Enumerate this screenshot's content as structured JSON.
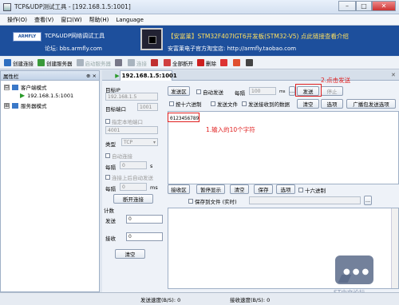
{
  "window": {
    "title": "TCP&UDP测试工具 - [192.168.1.5:1001]",
    "minimize": "–",
    "maximize": "□",
    "close": "✕"
  },
  "menu": [
    "操作(O)",
    "查看(V)",
    "窗口(W)",
    "帮助(H)",
    "Language"
  ],
  "banner": {
    "logo": "ARMFLY",
    "app_name": "TCP&UDP网络调试工具",
    "forum": "论坛: bbs.armfly.com",
    "ad_line1": "【安富莱】STM32F407IGT6开发板(STM32-V5) 点此链接查看介绍",
    "ad_line2": "安富莱电子官方淘宝店: http://armfly.taobao.com"
  },
  "toolbar": [
    {
      "label": "创建连接",
      "icon": "create-connection-icon",
      "enabled": true,
      "color": "#2f6fc0"
    },
    {
      "label": "创建服务器",
      "icon": "create-server-icon",
      "enabled": true,
      "color": "#3a9a3a"
    },
    {
      "label": "启动服务器",
      "icon": "start-server-icon",
      "enabled": false,
      "color": "#a9b4bf"
    },
    {
      "label": "",
      "icon": "settings-icon",
      "enabled": true,
      "color": "#778"
    },
    {
      "label": "连接",
      "icon": "connect-icon",
      "enabled": false,
      "color": "#a9b4bf"
    },
    {
      "label": "",
      "icon": "disconnect-icon",
      "enabled": true,
      "color": "#c03030"
    },
    {
      "label": "全部断开",
      "icon": "disconnect-all-icon",
      "enabled": true,
      "color": "#d04040"
    },
    {
      "label": "删除",
      "icon": "delete-icon",
      "enabled": true,
      "color": "#cc2020"
    },
    {
      "label": "",
      "icon": "delete-all-icon",
      "enabled": true,
      "color": "#dd3333"
    },
    {
      "label": "",
      "icon": "record-icon",
      "enabled": true,
      "color": "#e05030"
    },
    {
      "label": "",
      "icon": "help-icon",
      "enabled": true,
      "color": "#444"
    }
  ],
  "sidebar": {
    "header": "属性栏",
    "pin": "⊕ ×",
    "tree": [
      {
        "label": "客户端模式",
        "expander": "⊟"
      },
      {
        "label": "192.168.1.5:1001"
      },
      {
        "label": "服务器模式",
        "expander": "⊞"
      }
    ]
  },
  "tab": {
    "label": "192.168.1.5:1001",
    "close": "✕"
  },
  "conn": {
    "target_ip_label": "目标IP",
    "target_ip_value": "192.168.1.5",
    "target_port_label": "目标端口",
    "target_port_value": "1001",
    "local_port_check": "指定本地端口",
    "local_port_value": "4001",
    "type_label": "类型",
    "type_value": "TCP",
    "auto_connect": "自动连接",
    "interval_label1": "每隔",
    "interval_value1": "0",
    "interval_unit1": "s",
    "auto_send_after": "连接上后自动发送",
    "interval_label2": "每隔",
    "interval_value2": "0",
    "interval_unit2": "ms",
    "disconnect_btn": "断开连接"
  },
  "counter": {
    "title": "计数",
    "send_label": "发送",
    "send_value": "0",
    "recv_label": "接收",
    "recv_value": "0",
    "clear_btn": "清空"
  },
  "send": {
    "section": "发送区",
    "auto_send": "自动发送",
    "interval_label": "每隔",
    "interval_value": "100",
    "interval_unit": "ms",
    "file_btn": "...",
    "send_btn": "发送",
    "stop_btn": "停止",
    "hex": "按十六进制",
    "send_file": "发送文件",
    "send_received": "发送接收到的数据",
    "clear_btn": "清空",
    "options_btn": "选项",
    "broadcast_btn": "广播包发送选项",
    "content": "0123456789",
    "annot_input": "1.输入的10个字符",
    "annot_send": "2.点击发送"
  },
  "recv": {
    "section": "接收区",
    "pause_btn": "暂停显示",
    "clear_btn": "清空",
    "save_btn": "保存",
    "options_btn": "选项",
    "hex": "十六进制",
    "save_to_file": "保存到文件 (实时)",
    "file_btn": "..."
  },
  "status": {
    "send_speed": "发送速度(B/S): 0",
    "recv_speed": "接收速度(B/S): 0"
  },
  "watermark": "ST中文论坛"
}
